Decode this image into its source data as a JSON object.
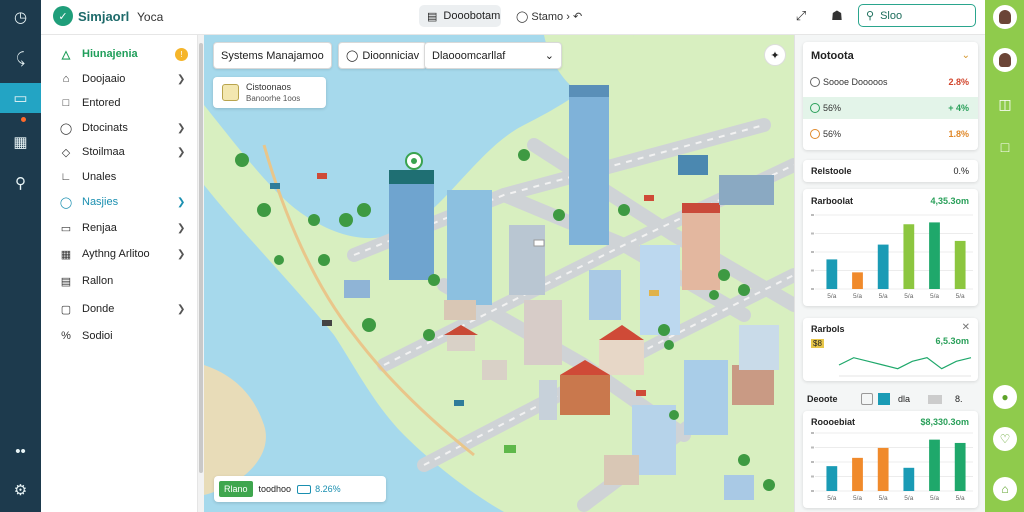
{
  "topbar": {
    "brand": "Simjaorl",
    "brand_sub": "Yoca",
    "view_pill": "Dooobotam",
    "status_text": "Stamo",
    "search_value": "Sloo"
  },
  "sidebar": {
    "items": [
      {
        "label": "Hiunajenia",
        "icon": "warning-icon",
        "badge": "!"
      },
      {
        "label": "Doojaaio",
        "icon": "home-icon",
        "chevron": true
      },
      {
        "label": "Entored",
        "icon": "box-icon"
      },
      {
        "label": "Dtocinats",
        "icon": "search-icon",
        "chevron": true
      },
      {
        "label": "Stoilmaa",
        "icon": "tag-icon",
        "chevron": true
      },
      {
        "label": "Unales",
        "icon": "layers-icon"
      },
      {
        "label": "Nasjies",
        "icon": "circle-icon",
        "chevron": true
      },
      {
        "label": "Renjaa",
        "icon": "card-icon",
        "chevron": true
      },
      {
        "label": "Aythng Arlitoo",
        "icon": "grid-icon",
        "chevron": true
      },
      {
        "label": "Rallon",
        "icon": "doc-icon"
      },
      {
        "label": "Donde",
        "icon": "chart-icon",
        "chevron": true
      },
      {
        "label": "Sodioi",
        "icon": "percent-icon"
      }
    ]
  },
  "map": {
    "ctrl_title": "Systems Manajamoo",
    "ctrl_mid": "Dioonniciav",
    "ctrl_dropdown": "Dlaooomcarllaf",
    "card_title": "Cistoonaos",
    "card_sub": "Banoorhe 1oos",
    "bottom_btn": "Rlano",
    "bottom_text": "toodhoo",
    "bottom_pct": "8.26%"
  },
  "panel": {
    "metrics": {
      "title": "Motoota",
      "rows": [
        {
          "label": "Soooe Dooooos",
          "value": "2.8%",
          "color": "#d2452c"
        },
        {
          "label": "56%",
          "value": "+ 4%",
          "color": "#2aa05a"
        },
        {
          "label": "56%",
          "value": "1.8%",
          "color": "#e0892a"
        }
      ]
    },
    "status": {
      "title": "Relstoole",
      "value": "0.%"
    },
    "chart1": {
      "title": "Rarboolat",
      "value": "4,35.3om"
    },
    "chart2": {
      "title": "Rarbols",
      "value": "6,5.3om",
      "badge": "$8"
    },
    "tabs": [
      "Deoote",
      "dla",
      "8."
    ],
    "chart3": {
      "title": "Roooebiat",
      "value": "$8,330.3om"
    }
  },
  "chart_data": [
    {
      "type": "bar",
      "categories": [
        "5/a",
        "5/a",
        "5/a",
        "5/a",
        "5/a",
        "5/a"
      ],
      "values": [
        32,
        18,
        48,
        70,
        72,
        52
      ],
      "colors": [
        "#1a9bb5",
        "#f08a2b",
        "#1a9bb5",
        "#8cc63f",
        "#1fa86b",
        "#8cc63f"
      ],
      "ylim": [
        0,
        80
      ]
    },
    {
      "type": "line",
      "values": [
        3,
        5,
        4,
        3,
        2,
        4,
        5,
        2,
        4,
        5
      ],
      "ylim": [
        0,
        6
      ]
    },
    {
      "type": "bar",
      "categories": [
        "5/a",
        "5/a",
        "5/a",
        "5/a",
        "5/a",
        "5/a"
      ],
      "values": [
        30,
        40,
        52,
        28,
        62,
        58
      ],
      "colors": [
        "#1a9bb5",
        "#f08a2b",
        "#f08a2b",
        "#1a9bb5",
        "#1fa86b",
        "#1fa86b"
      ],
      "ylim": [
        0,
        70
      ]
    }
  ]
}
